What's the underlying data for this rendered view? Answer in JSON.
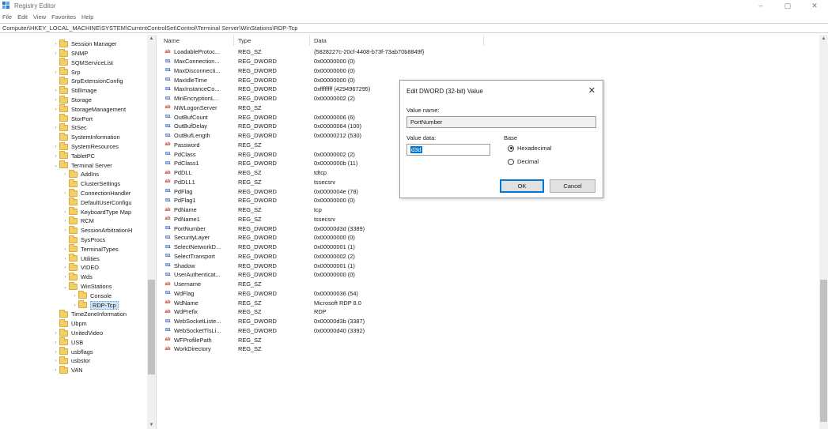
{
  "window": {
    "title": "Registry Editor",
    "controls": [
      "–",
      "▢",
      "✕"
    ]
  },
  "menu": [
    "File",
    "Edit",
    "View",
    "Favorites",
    "Help"
  ],
  "address": "Computer\\HKEY_LOCAL_MACHINE\\SYSTEM\\CurrentControlSet\\Control\\Terminal Server\\WinStations\\RDP-Tcp",
  "tree": [
    {
      "label": "Session Manager",
      "level": 0,
      "exp": "›"
    },
    {
      "label": "SNMP",
      "level": 0,
      "exp": "›"
    },
    {
      "label": "SQMServiceList",
      "level": 0,
      "exp": ""
    },
    {
      "label": "Srp",
      "level": 0,
      "exp": "›"
    },
    {
      "label": "SrpExtensionConfig",
      "level": 0,
      "exp": ""
    },
    {
      "label": "StillImage",
      "level": 0,
      "exp": "›"
    },
    {
      "label": "Storage",
      "level": 0,
      "exp": "›"
    },
    {
      "label": "StorageManagement",
      "level": 0,
      "exp": "›"
    },
    {
      "label": "StorPort",
      "level": 0,
      "exp": ""
    },
    {
      "label": "StSec",
      "level": 0,
      "exp": "›"
    },
    {
      "label": "SystemInformation",
      "level": 0,
      "exp": ""
    },
    {
      "label": "SystemResources",
      "level": 0,
      "exp": "›"
    },
    {
      "label": "TabletPC",
      "level": 0,
      "exp": "›"
    },
    {
      "label": "Terminal Server",
      "level": 0,
      "exp": "⌄"
    },
    {
      "label": "AddIns",
      "level": 1,
      "exp": "›"
    },
    {
      "label": "ClusterSettings",
      "level": 1,
      "exp": ""
    },
    {
      "label": "ConnectionHandler",
      "level": 1,
      "exp": "›"
    },
    {
      "label": "DefaultUserConfigu",
      "level": 1,
      "exp": ""
    },
    {
      "label": "KeyboardType Map",
      "level": 1,
      "exp": "›"
    },
    {
      "label": "RCM",
      "level": 1,
      "exp": "›"
    },
    {
      "label": "SessionArbitrationH",
      "level": 1,
      "exp": "›"
    },
    {
      "label": "SysProcs",
      "level": 1,
      "exp": ""
    },
    {
      "label": "TerminalTypes",
      "level": 1,
      "exp": "›"
    },
    {
      "label": "Utilities",
      "level": 1,
      "exp": "›"
    },
    {
      "label": "VIDEO",
      "level": 1,
      "exp": "›"
    },
    {
      "label": "Wds",
      "level": 1,
      "exp": "›"
    },
    {
      "label": "WinStations",
      "level": 1,
      "exp": "⌄"
    },
    {
      "label": "Console",
      "level": 2,
      "exp": "›"
    },
    {
      "label": "RDP-Tcp",
      "level": 2,
      "exp": "›",
      "selected": true
    },
    {
      "label": "TimeZoneInformation",
      "level": 0,
      "exp": ""
    },
    {
      "label": "Ubpm",
      "level": 0,
      "exp": ""
    },
    {
      "label": "UnitedVideo",
      "level": 0,
      "exp": "›"
    },
    {
      "label": "USB",
      "level": 0,
      "exp": "›"
    },
    {
      "label": "usbflags",
      "level": 0,
      "exp": "›"
    },
    {
      "label": "usbstor",
      "level": 0,
      "exp": "›"
    },
    {
      "label": "VAN",
      "level": 0,
      "exp": "›"
    }
  ],
  "columns": {
    "name": "Name",
    "type": "Type",
    "data": "Data"
  },
  "values": [
    {
      "name": "LoadableProtoc...",
      "type": "REG_SZ",
      "data": "{5828227c-20cf-4408-b73f-73ab70b8849f}",
      "kind": "sz"
    },
    {
      "name": "MaxConnection...",
      "type": "REG_DWORD",
      "data": "0x00000000 (0)",
      "kind": "dword"
    },
    {
      "name": "MaxDisconnecti...",
      "type": "REG_DWORD",
      "data": "0x00000000 (0)",
      "kind": "dword"
    },
    {
      "name": "MaxIdleTime",
      "type": "REG_DWORD",
      "data": "0x00000000 (0)",
      "kind": "dword"
    },
    {
      "name": "MaxInstanceCo...",
      "type": "REG_DWORD",
      "data": "0xffffffff (4294967295)",
      "kind": "dword"
    },
    {
      "name": "MinEncryptionL...",
      "type": "REG_DWORD",
      "data": "0x00000002 (2)",
      "kind": "dword"
    },
    {
      "name": "NWLogonServer",
      "type": "REG_SZ",
      "data": "",
      "kind": "sz"
    },
    {
      "name": "OutBufCount",
      "type": "REG_DWORD",
      "data": "0x00000006 (6)",
      "kind": "dword"
    },
    {
      "name": "OutBufDelay",
      "type": "REG_DWORD",
      "data": "0x00000064 (100)",
      "kind": "dword"
    },
    {
      "name": "OutBufLength",
      "type": "REG_DWORD",
      "data": "0x00000212 (530)",
      "kind": "dword"
    },
    {
      "name": "Password",
      "type": "REG_SZ",
      "data": "",
      "kind": "sz"
    },
    {
      "name": "PdClass",
      "type": "REG_DWORD",
      "data": "0x00000002 (2)",
      "kind": "dword"
    },
    {
      "name": "PdClass1",
      "type": "REG_DWORD",
      "data": "0x0000000b (11)",
      "kind": "dword"
    },
    {
      "name": "PdDLL",
      "type": "REG_SZ",
      "data": "tdtcp",
      "kind": "sz"
    },
    {
      "name": "PdDLL1",
      "type": "REG_SZ",
      "data": "tssecsrv",
      "kind": "sz"
    },
    {
      "name": "PdFlag",
      "type": "REG_DWORD",
      "data": "0x0000004e (78)",
      "kind": "dword"
    },
    {
      "name": "PdFlag1",
      "type": "REG_DWORD",
      "data": "0x00000000 (0)",
      "kind": "dword"
    },
    {
      "name": "PdName",
      "type": "REG_SZ",
      "data": "tcp",
      "kind": "sz"
    },
    {
      "name": "PdName1",
      "type": "REG_SZ",
      "data": "tssecsrv",
      "kind": "sz"
    },
    {
      "name": "PortNumber",
      "type": "REG_DWORD",
      "data": "0x00000d3d (3389)",
      "kind": "dword"
    },
    {
      "name": "SecurityLayer",
      "type": "REG_DWORD",
      "data": "0x00000000 (0)",
      "kind": "dword"
    },
    {
      "name": "SelectNetworkD...",
      "type": "REG_DWORD",
      "data": "0x00000001 (1)",
      "kind": "dword"
    },
    {
      "name": "SelectTransport",
      "type": "REG_DWORD",
      "data": "0x00000002 (2)",
      "kind": "dword"
    },
    {
      "name": "Shadow",
      "type": "REG_DWORD",
      "data": "0x00000001 (1)",
      "kind": "dword"
    },
    {
      "name": "UserAuthenticat...",
      "type": "REG_DWORD",
      "data": "0x00000000 (0)",
      "kind": "dword"
    },
    {
      "name": "Username",
      "type": "REG_SZ",
      "data": "",
      "kind": "sz"
    },
    {
      "name": "WdFlag",
      "type": "REG_DWORD",
      "data": "0x00000036 (54)",
      "kind": "dword"
    },
    {
      "name": "WdName",
      "type": "REG_SZ",
      "data": "Microsoft RDP 8.0",
      "kind": "sz"
    },
    {
      "name": "WdPrefix",
      "type": "REG_SZ",
      "data": "RDP",
      "kind": "sz"
    },
    {
      "name": "WebSocketListe...",
      "type": "REG_DWORD",
      "data": "0x00000d3b (3387)",
      "kind": "dword"
    },
    {
      "name": "WebSocketTlsLi...",
      "type": "REG_DWORD",
      "data": "0x00000d40 (3392)",
      "kind": "dword"
    },
    {
      "name": "WFProfilePath",
      "type": "REG_SZ",
      "data": "",
      "kind": "sz"
    },
    {
      "name": "WorkDirectory",
      "type": "REG_SZ",
      "data": "",
      "kind": "sz"
    }
  ],
  "dialog": {
    "title": "Edit DWORD (32-bit) Value",
    "close": "✕",
    "value_name_label": "Value name:",
    "value_name": "PortNumber",
    "value_data_label": "Value data:",
    "value_data": "d3d",
    "base_label": "Base",
    "hex_label": "Hexadecimal",
    "dec_label": "Decimal",
    "ok_label": "OK",
    "cancel_label": "Cancel"
  },
  "accent_color": "#0078d7"
}
